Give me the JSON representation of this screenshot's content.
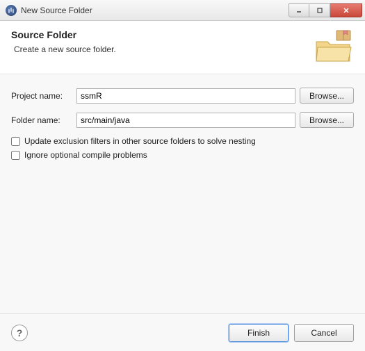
{
  "window": {
    "title": "New Source Folder"
  },
  "header": {
    "title": "Source Folder",
    "subtitle": "Create a new source folder."
  },
  "form": {
    "projectNameLabel": "Project name:",
    "projectNameValue": "ssmR",
    "projectBrowseLabel": "Browse...",
    "folderNameLabel": "Folder name:",
    "folderNameValue": "src/main/java",
    "folderBrowseLabel": "Browse...",
    "updateExclusionLabel": "Update exclusion filters in other source folders to solve nesting",
    "ignoreOptionalLabel": "Ignore optional compile problems"
  },
  "footer": {
    "helpLabel": "?",
    "finishLabel": "Finish",
    "cancelLabel": "Cancel"
  }
}
